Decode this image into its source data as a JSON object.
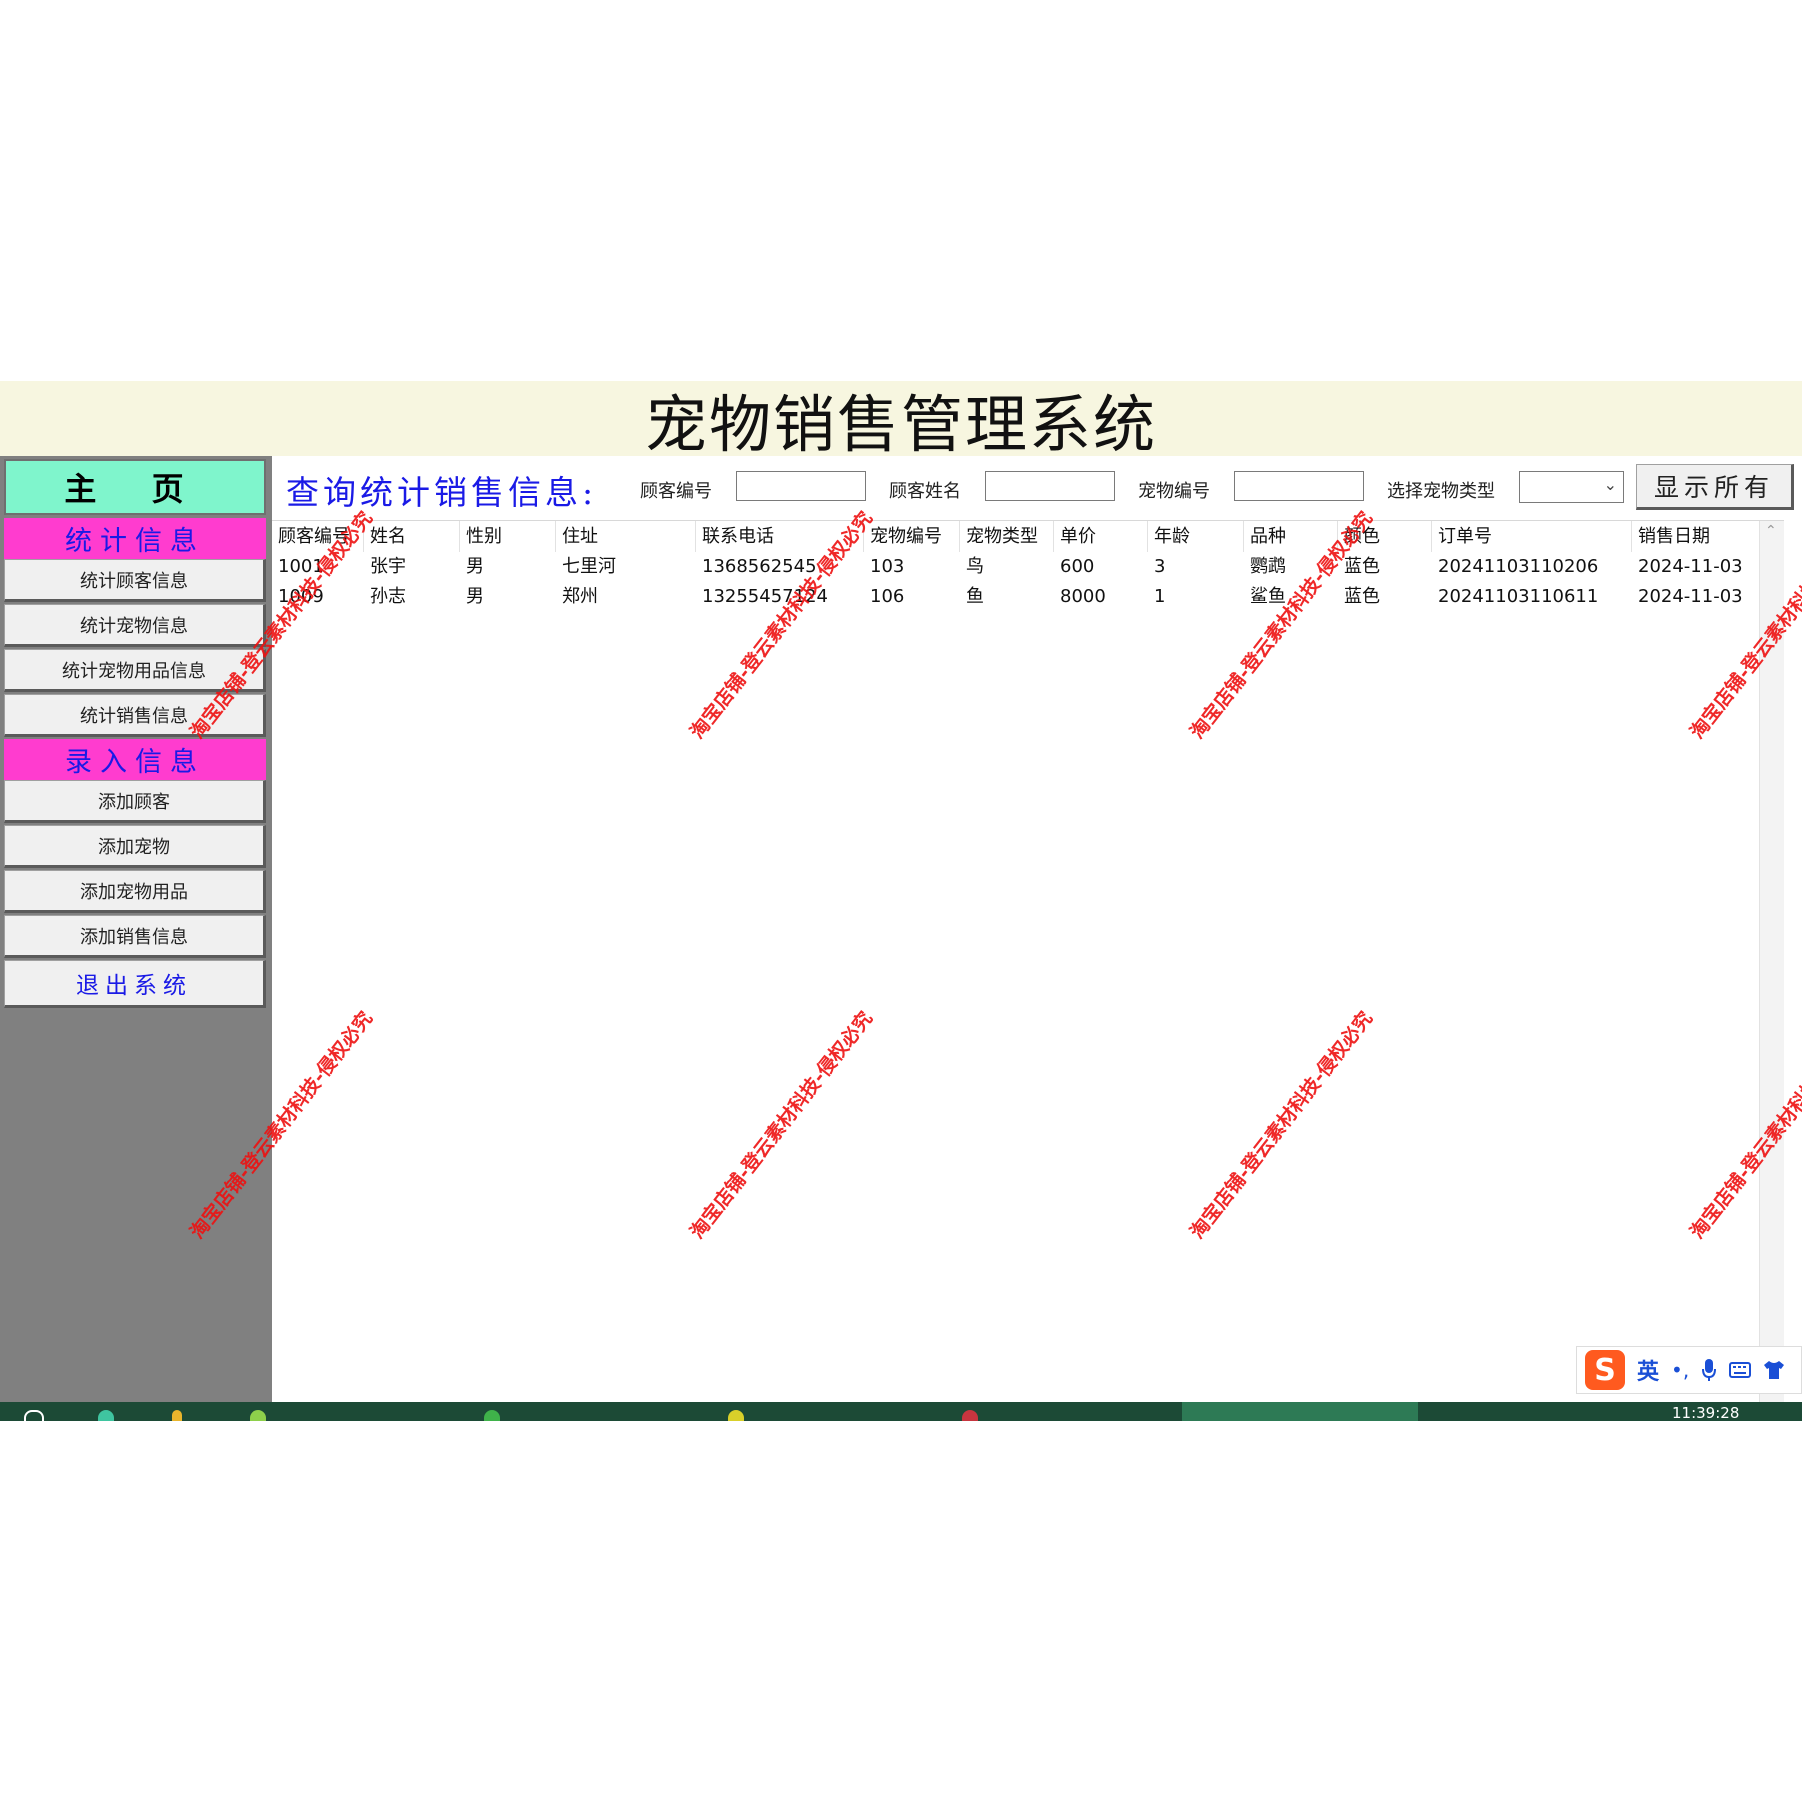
{
  "window": {
    "title": "宠物销售管理系统"
  },
  "sidebar": {
    "home_label": "主 页",
    "sections": [
      {
        "label": "统计信息",
        "items": [
          "统计顾客信息",
          "统计宠物信息",
          "统计宠物用品信息",
          "统计销售信息"
        ]
      },
      {
        "label": "录入信息",
        "items": [
          "添加顾客",
          "添加宠物",
          "添加宠物用品",
          "添加销售信息"
        ]
      }
    ],
    "exit_label": "退出系统"
  },
  "toolbar": {
    "title": "查询统计销售信息:",
    "customer_id_label": "顾客编号",
    "customer_id_value": "",
    "customer_name_label": "顾客姓名",
    "customer_name_value": "",
    "pet_id_label": "宠物编号",
    "pet_id_value": "",
    "pet_type_label": "选择宠物类型",
    "pet_type_value": "",
    "show_all_label": "显示所有"
  },
  "table": {
    "columns": [
      "顾客编号",
      "姓名",
      "性别",
      "住址",
      "联系电话",
      "宠物编号",
      "宠物类型",
      "单价",
      "年龄",
      "品种",
      "颜色",
      "订单号",
      "销售日期"
    ],
    "rows": [
      [
        "1001",
        "张宇",
        "男",
        "七里河",
        "1368562545",
        "103",
        "鸟",
        "600",
        "3",
        "鹦鹉",
        "蓝色",
        "20241103110206",
        "2024-11-03"
      ],
      [
        "1009",
        "孙志",
        "男",
        "郑州",
        "13255457124",
        "106",
        "鱼",
        "8000",
        "1",
        "鲨鱼",
        "蓝色",
        "20241103110611",
        "2024-11-03"
      ]
    ]
  },
  "ime": {
    "lang": "英",
    "logo": "S"
  },
  "taskbar": {
    "clock": "11:39:28"
  },
  "watermark": "淘宝店铺-登云素材科技-侵权必究",
  "colors": {
    "title_bg": "#f7f6e0",
    "home_bg": "#7ff5cc",
    "section_bg": "#ff3ccf",
    "accent_blue": "#1a1ae6",
    "sidebar_bg": "#808080",
    "watermark": "#e11111",
    "taskbar": "#1c4a36"
  }
}
